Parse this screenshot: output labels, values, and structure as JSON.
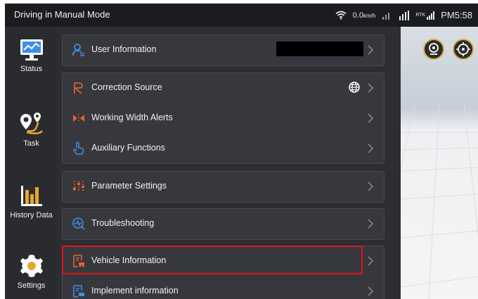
{
  "status_bar": {
    "title": "Driving in Manual Mode",
    "speed": "0.0",
    "speed_unit": "km/h",
    "rtk": "RTK",
    "time": "PM5:58"
  },
  "sidebar": {
    "items": [
      {
        "label": "Status"
      },
      {
        "label": "Task"
      },
      {
        "label": "History Data"
      },
      {
        "label": "Settings"
      }
    ]
  },
  "menu": {
    "user_information": "User Information",
    "correction_source": "Correction Source",
    "working_width_alerts": "Working Width Alerts",
    "auxiliary_functions": "Auxiliary Functions",
    "parameter_settings": "Parameter Settings",
    "troubleshooting": "Troubleshooting",
    "vehicle_information": "Vehicle Information",
    "implement_information": "Implement information"
  },
  "colors": {
    "accent": "#e8622c",
    "icon_blue": "#3f8ee8",
    "highlight": "#e0151c",
    "map_button_ring": "#d9b13b"
  }
}
